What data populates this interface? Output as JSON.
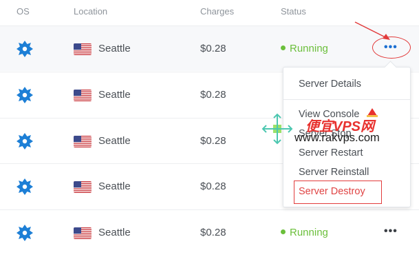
{
  "table": {
    "headers": {
      "os": "OS",
      "location": "Location",
      "charges": "Charges",
      "status": "Status"
    },
    "rows": [
      {
        "location": "Seattle",
        "charges": "$0.28",
        "status": "Running",
        "highlighted": true,
        "menu_open": true
      },
      {
        "location": "Seattle",
        "charges": "$0.28",
        "status": "",
        "highlighted": false,
        "menu_open": false
      },
      {
        "location": "Seattle",
        "charges": "$0.28",
        "status": "",
        "highlighted": false,
        "menu_open": false
      },
      {
        "location": "Seattle",
        "charges": "$0.28",
        "status": "",
        "highlighted": false,
        "menu_open": false
      },
      {
        "location": "Seattle",
        "charges": "$0.28",
        "status": "Running",
        "highlighted": false,
        "menu_open": false
      }
    ]
  },
  "actions_menu": {
    "items": [
      "Server Details",
      "View Console",
      "Server Stop",
      "Server Restart",
      "Server Reinstall",
      "Server Destroy"
    ]
  },
  "watermark": {
    "text": "便宜VPS网",
    "url": "www.rakvps.com"
  },
  "colors": {
    "accent": "#1b6fd1",
    "running": "#6bbf3b",
    "danger": "#e04444",
    "annotation": "#e23b3b"
  },
  "icons": {
    "os": "os-logo-icon",
    "flag": "us-flag-icon",
    "more": "more-dots-icon"
  }
}
